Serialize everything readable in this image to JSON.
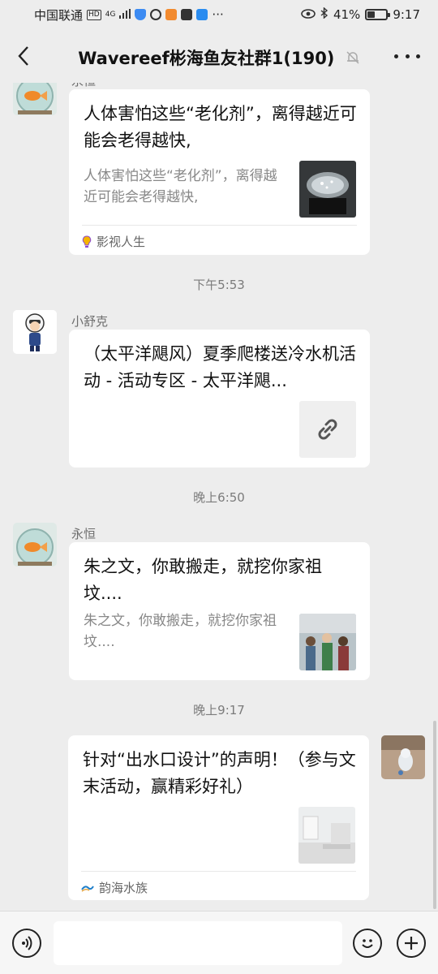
{
  "status_bar": {
    "carrier": "中国联通",
    "network": "4G",
    "battery": "41%",
    "battery_level": 0.41,
    "time": "9:17"
  },
  "header": {
    "title": "Wavereef彬海鱼友社群1(190)"
  },
  "messages": [
    {
      "sender": "永恒",
      "title": "人体害怕这些“老化剂”，离得越近可能会老得越快,",
      "desc": "人体害怕这些“老化剂”，离得越近可能会老得越快,",
      "source": "影视人生"
    },
    {
      "sender": "小舒克",
      "title": "（太平洋飓风）夏季爬楼送冷水机活动 - 活动专区 - 太平洋飓..."
    },
    {
      "sender": "永恒",
      "title": "朱之文，你敢搬走，就挖你家祖坟....",
      "desc": "朱之文，你敢搬走，就挖你家祖坟...."
    },
    {
      "title": "针对“出水口设计”的声明！（参与文末活动，赢精彩好礼）",
      "source": "韵海水族"
    }
  ],
  "timestamps": [
    "下午5:53",
    "晚上6:50",
    "晚上9:17"
  ],
  "colors": {
    "background": "#ededed",
    "card": "#ffffff",
    "link_icon_bg": "#efefef"
  }
}
